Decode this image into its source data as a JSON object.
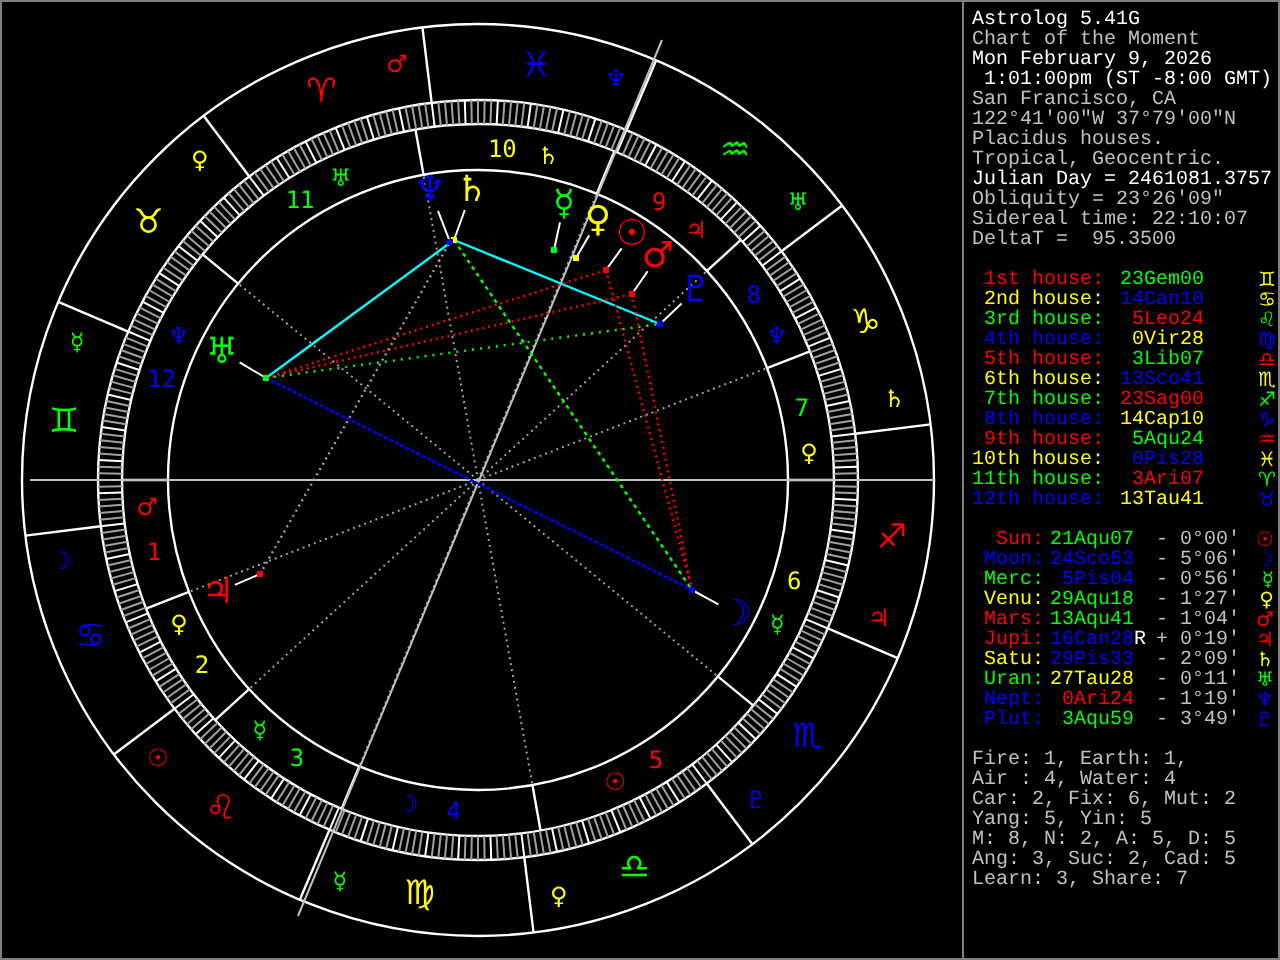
{
  "wheel": {
    "signs": [
      {
        "glyph": "♈",
        "color": "#ff0000",
        "ruler": {
          "glyph": "♂",
          "color": "#ff0000"
        }
      },
      {
        "glyph": "♉",
        "color": "#ffff00",
        "ruler": {
          "glyph": "♀",
          "color": "#ffff00"
        }
      },
      {
        "glyph": "♊",
        "color": "#00ff00",
        "ruler": {
          "glyph": "☿",
          "color": "#00ff00"
        }
      },
      {
        "glyph": "♋",
        "color": "#0000ff",
        "ruler": {
          "glyph": "☽",
          "color": "#0000ff"
        }
      },
      {
        "glyph": "♌",
        "color": "#ff0000",
        "ruler": {
          "glyph": "☉",
          "color": "#ff0000"
        }
      },
      {
        "glyph": "♍",
        "color": "#ffff00",
        "ruler": {
          "glyph": "☿",
          "color": "#00ff00"
        }
      },
      {
        "glyph": "♎",
        "color": "#00ff00",
        "ruler": {
          "glyph": "♀",
          "color": "#ffff00"
        }
      },
      {
        "glyph": "♏",
        "color": "#0000ff",
        "ruler": {
          "glyph": "♇",
          "color": "#0000ff"
        }
      },
      {
        "glyph": "♐",
        "color": "#ff0000",
        "ruler": {
          "glyph": "♃",
          "color": "#ff0000"
        }
      },
      {
        "glyph": "♑",
        "color": "#ffff00",
        "ruler": {
          "glyph": "♄",
          "color": "#ffff00"
        }
      },
      {
        "glyph": "♒",
        "color": "#00ff00",
        "ruler": {
          "glyph": "♅",
          "color": "#00ff00"
        }
      },
      {
        "glyph": "♓",
        "color": "#0000ff",
        "ruler": {
          "glyph": "♆",
          "color": "#0000ff"
        }
      }
    ],
    "houses": [
      {
        "number": "1",
        "color": "#ff0000",
        "ruler": {
          "glyph": "♂",
          "color": "#ff0000"
        }
      },
      {
        "number": "2",
        "color": "#ffff00",
        "ruler": {
          "glyph": "♀",
          "color": "#ffff00"
        }
      },
      {
        "number": "3",
        "color": "#00ff00",
        "ruler": {
          "glyph": "☿",
          "color": "#00ff00"
        }
      },
      {
        "number": "4",
        "color": "#0000ff",
        "ruler": {
          "glyph": "☽",
          "color": "#0000ff"
        }
      },
      {
        "number": "5",
        "color": "#ff0000",
        "ruler": {
          "glyph": "☉",
          "color": "#ff0000"
        }
      },
      {
        "number": "6",
        "color": "#ffff00",
        "ruler": {
          "glyph": "☿",
          "color": "#00ff00"
        }
      },
      {
        "number": "7",
        "color": "#00ff00",
        "ruler": {
          "glyph": "♀",
          "color": "#ffff00"
        }
      },
      {
        "number": "8",
        "color": "#0000ff",
        "ruler": {
          "glyph": "♆",
          "color": "#0000ff"
        }
      },
      {
        "number": "9",
        "color": "#ff0000",
        "ruler": {
          "glyph": "♃",
          "color": "#ff0000"
        }
      },
      {
        "number": "10",
        "color": "#ffff00",
        "ruler": {
          "glyph": "♄",
          "color": "#ffff00"
        }
      },
      {
        "number": "11",
        "color": "#00ff00",
        "ruler": {
          "glyph": "♅",
          "color": "#00ff00"
        }
      },
      {
        "number": "12",
        "color": "#0000ff",
        "ruler": {
          "glyph": "♆",
          "color": "#0000ff"
        }
      }
    ],
    "planets": [
      {
        "glyph": "☉",
        "color": "#ff0000"
      },
      {
        "glyph": "☽",
        "color": "#0000ff"
      },
      {
        "glyph": "☿",
        "color": "#00ff00"
      },
      {
        "glyph": "♀",
        "color": "#ffff00"
      },
      {
        "glyph": "♂",
        "color": "#ff0000"
      },
      {
        "glyph": "♃",
        "color": "#ff0000"
      },
      {
        "glyph": "♄",
        "color": "#ffff00"
      },
      {
        "glyph": "♅",
        "color": "#00ff00"
      },
      {
        "glyph": "♆",
        "color": "#0000ff"
      },
      {
        "glyph": "♇",
        "color": "#0000ff"
      }
    ]
  },
  "info": [
    {
      "text": "Astrolog 5.41G",
      "color": "#ffffff"
    },
    {
      "text": "Chart of the Moment",
      "color": "#c0c0c0"
    },
    {
      "text": "Mon February 9, 2026",
      "color": "#ffffff"
    },
    {
      "text": " 1:01:00pm (ST -8:00 GMT)",
      "color": "#ffffff"
    },
    {
      "text": "San Francisco, CA",
      "color": "#c0c0c0"
    },
    {
      "text": "122°41'00\"W 37°79'00\"N",
      "color": "#c0c0c0"
    },
    {
      "text": "Placidus houses.",
      "color": "#c0c0c0"
    },
    {
      "text": "Tropical, Geocentric.",
      "color": "#c0c0c0"
    },
    {
      "text": "Julian Day = 2461081.3757",
      "color": "#ffffff"
    },
    {
      "text": "Obliquity = 23°26'09\"",
      "color": "#c0c0c0"
    },
    {
      "text": "Sidereal time: 22:10:07",
      "color": "#c0c0c0"
    },
    {
      "text": "DeltaT =  95.3500",
      "color": "#c0c0c0"
    }
  ],
  "house_table": [
    {
      "label": {
        "text": "1st house:",
        "color": "#ff0000"
      },
      "position": {
        "text": "23Gem00",
        "color": "#00ff00"
      },
      "sign": {
        "glyph": "♊",
        "color": "#ffff00"
      }
    },
    {
      "label": {
        "text": "2nd house:",
        "color": "#ffff00"
      },
      "position": {
        "text": "14Can10",
        "color": "#0000ff"
      },
      "sign": {
        "glyph": "♋",
        "color": "#ffff00"
      }
    },
    {
      "label": {
        "text": "3rd house:",
        "color": "#00ff00"
      },
      "position": {
        "text": "5Leo24",
        "color": "#ff0000"
      },
      "sign": {
        "glyph": "♌",
        "color": "#00ff00"
      }
    },
    {
      "label": {
        "text": "4th house:",
        "color": "#0000ff"
      },
      "position": {
        "text": "0Vir28",
        "color": "#ffff00"
      },
      "sign": {
        "glyph": "♍",
        "color": "#0000ff"
      }
    },
    {
      "label": {
        "text": "5th house:",
        "color": "#ff0000"
      },
      "position": {
        "text": "3Lib07",
        "color": "#00ff00"
      },
      "sign": {
        "glyph": "♎",
        "color": "#ff0000"
      }
    },
    {
      "label": {
        "text": "6th house:",
        "color": "#ffff00"
      },
      "position": {
        "text": "13Sco41",
        "color": "#0000ff"
      },
      "sign": {
        "glyph": "♏",
        "color": "#ffff00"
      }
    },
    {
      "label": {
        "text": "7th house:",
        "color": "#00ff00"
      },
      "position": {
        "text": "23Sag00",
        "color": "#ff0000"
      },
      "sign": {
        "glyph": "♐",
        "color": "#00ff00"
      }
    },
    {
      "label": {
        "text": "8th house:",
        "color": "#0000ff"
      },
      "position": {
        "text": "14Cap10",
        "color": "#ffff00"
      },
      "sign": {
        "glyph": "♑",
        "color": "#0000ff"
      }
    },
    {
      "label": {
        "text": "9th house:",
        "color": "#ff0000"
      },
      "position": {
        "text": "5Aqu24",
        "color": "#00ff00"
      },
      "sign": {
        "glyph": "♒",
        "color": "#ff0000"
      }
    },
    {
      "label": {
        "text": "10th house:",
        "color": "#ffff00"
      },
      "position": {
        "text": "0Pis28",
        "color": "#0000ff"
      },
      "sign": {
        "glyph": "♓",
        "color": "#ffff00"
      }
    },
    {
      "label": {
        "text": "11th house:",
        "color": "#00ff00"
      },
      "position": {
        "text": "3Ari07",
        "color": "#ff0000"
      },
      "sign": {
        "glyph": "♈",
        "color": "#00ff00"
      }
    },
    {
      "label": {
        "text": "12th house:",
        "color": "#0000ff"
      },
      "position": {
        "text": "13Tau41",
        "color": "#ffff00"
      },
      "sign": {
        "glyph": "♉",
        "color": "#0000ff"
      }
    }
  ],
  "planet_table": [
    {
      "name": "Sun:",
      "color": "#ff0000",
      "position": {
        "text": "21Aqu07",
        "color": "#00ff00"
      },
      "speed": "- 0°00'",
      "glyph": "☉"
    },
    {
      "name": "Moon:",
      "color": "#0000ff",
      "position": {
        "text": "24Sco53",
        "color": "#0000ff"
      },
      "speed": "- 5°06'",
      "glyph": "☽"
    },
    {
      "name": "Merc:",
      "color": "#00ff00",
      "position": {
        "text": "5Pis04",
        "color": "#0000ff"
      },
      "speed": "- 0°56'",
      "glyph": "☿"
    },
    {
      "name": "Venu:",
      "color": "#ffff00",
      "position": {
        "text": "29Aqu18",
        "color": "#00ff00"
      },
      "speed": "- 1°27'",
      "glyph": "♀"
    },
    {
      "name": "Mars:",
      "color": "#ff0000",
      "position": {
        "text": "13Aqu41",
        "color": "#00ff00"
      },
      "speed": "- 1°04'",
      "glyph": "♂"
    },
    {
      "name": "Jupi:",
      "color": "#ff0000",
      "position": {
        "text": "16Can28",
        "color": "#0000ff"
      },
      "flag": "R",
      "speed": "+ 0°19'",
      "glyph": "♃"
    },
    {
      "name": "Satu:",
      "color": "#ffff00",
      "position": {
        "text": "29Pis33",
        "color": "#0000ff"
      },
      "speed": "- 2°09'",
      "glyph": "♄"
    },
    {
      "name": "Uran:",
      "color": "#00ff00",
      "position": {
        "text": "27Tau28",
        "color": "#ffff00"
      },
      "speed": "- 0°11'",
      "glyph": "♅"
    },
    {
      "name": "Nept:",
      "color": "#0000ff",
      "position": {
        "text": "0Ari24",
        "color": "#ff0000"
      },
      "speed": "- 1°19'",
      "glyph": "♆"
    },
    {
      "name": "Plut:",
      "color": "#0000ff",
      "position": {
        "text": "3Aqu59",
        "color": "#00ff00"
      },
      "speed": "- 3°49'",
      "glyph": "♇"
    }
  ],
  "summary": [
    "Fire: 1, Earth: 1,",
    "Air : 4, Water: 4",
    "Car: 2, Fix: 6, Mut: 2",
    "Yang: 5, Yin: 5",
    "M: 8, N: 2, A: 5, D: 5",
    "Ang: 3, Suc: 2, Cad: 5",
    "Learn: 3, Share: 7"
  ]
}
